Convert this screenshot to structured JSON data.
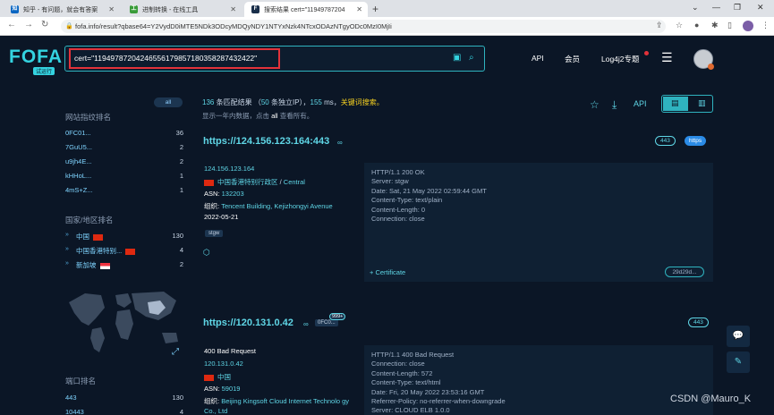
{
  "browser": {
    "tabs": [
      {
        "title": "知乎 - 有问题，就会有答案",
        "icon": "zhihu-icon",
        "letter": "知"
      },
      {
        "title": "进制转换 - 在线工具",
        "icon": "tool-icon",
        "letter": "工"
      },
      {
        "title": "搜索结果 cert=\"11949787204",
        "icon": "fofa-icon",
        "letter": "F"
      }
    ],
    "url": "fofa.info/result?qbase64=Y2VydD0iMTE5NDk3ODcyMDQyNDY1NTYxNzk4NTcxODAzNTgyODc0MzI0MjIi"
  },
  "header": {
    "logo": "FOFA",
    "logo_badge": "试运行",
    "search_value": "cert=\"119497872042465561798571803582874324​22\"",
    "nav": {
      "api": "API",
      "member": "会员",
      "log4j": "Log4j2专题"
    }
  },
  "sidebar": {
    "all_label": "all",
    "website_title": "网站指纹排名",
    "fingerprints": [
      {
        "name": "0FC01...",
        "count": "36"
      },
      {
        "name": "7GuU5...",
        "count": "2"
      },
      {
        "name": "u9jh4E...",
        "count": "2"
      },
      {
        "name": "kHHoL...",
        "count": "1"
      },
      {
        "name": "4mS+Z...",
        "count": "1"
      }
    ],
    "country_title": "国家/地区排名",
    "countries": [
      {
        "name": "中国",
        "count": "130",
        "flag": "cn"
      },
      {
        "name": "中国香港特别...",
        "count": "4",
        "flag": "hk"
      },
      {
        "name": "新加坡",
        "count": "2",
        "flag": "sg"
      }
    ],
    "port_title": "端口排名",
    "ports": [
      {
        "name": "443",
        "count": "130"
      },
      {
        "name": "10443",
        "count": "4"
      }
    ]
  },
  "summary": {
    "count": "136",
    "count_text": "条匹配结果 （",
    "ip_count": "50",
    "ip_text": "条独立IP），",
    "time": "155",
    "time_unit": "ms，",
    "keyword": "关键词搜索。",
    "line2_a": "显示一年内数据，点击",
    "line2_all": "all",
    "line2_b": "查看所有。",
    "api_label": "API"
  },
  "results": [
    {
      "url": "https://124.156.123.164:443",
      "port": "443",
      "protocol": "https",
      "ip": "124.156.123.164",
      "region": "中国香港特别行政区",
      "sep": "/",
      "city": "Central",
      "asn_label": "ASN:",
      "asn": "132203",
      "org_label": "组织:",
      "org": "Tencent Building, Kejizhongyi Avenue",
      "date": "2022-05-21",
      "tag": "stgw",
      "headers": "HTTP/1.1 200 OK\nServer: stgw\nDate: Sat, 21 May 2022 02:59:44 GMT\nContent-Type: text/plain\nContent-Length: 0\nConnection: close",
      "cert_label": "+ Certificate",
      "cert_hash": "29d29d..."
    },
    {
      "url": "https://120.131.0.42",
      "port": "443",
      "fingerprint_badge": "0FC0...",
      "fingerprint_count": "999+",
      "title": "400 Bad Request",
      "ip": "120.131.0.42",
      "region": "中国",
      "asn_label": "ASN:",
      "asn": "59019",
      "org_label": "组织:",
      "org": "Beijing Kingsoft Cloud Internet Technolo gy Co., Ltd",
      "headers": "HTTP/1.1 400 Bad Request\nConnection: close\nContent-Length: 572\nContent-Type: text/html\nDate: Fri, 20 May 2022 23:53:16 GMT\nReferrer-Policy: no-referrer-when-downgrade\nServer: CLOUD ELB 1.0.0"
    }
  ],
  "watermark": "CSDN @Mauro_K"
}
